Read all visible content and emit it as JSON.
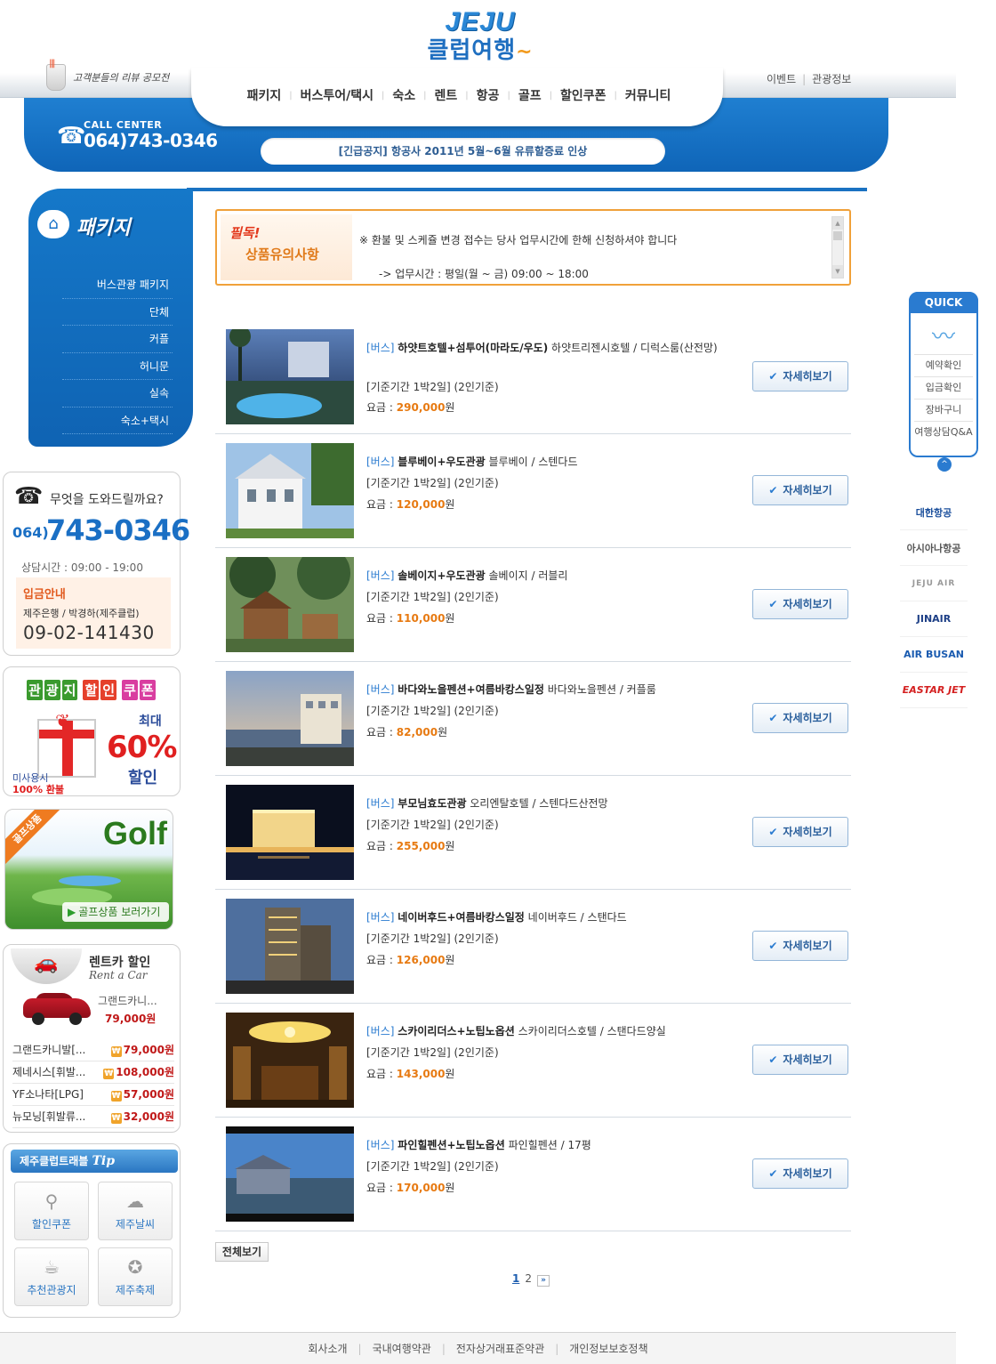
{
  "header": {
    "logo_top": "JEJU",
    "logo_main": "클럽여행",
    "review_banner": "고객분들의 리뷰 공모전",
    "util_links": [
      "이벤트",
      "관광정보"
    ],
    "nav": [
      "패키지",
      "버스투어/택시",
      "숙소",
      "렌트",
      "항공",
      "골프",
      "할인쿠폰",
      "커뮤니티"
    ],
    "call_center_label": "CALL CENTER",
    "call_center_number": "064)743-0346",
    "notice": "[긴급공지] 항공사 2011년 5월~6월 유류할증료 인상"
  },
  "sidebar": {
    "title": "패키지",
    "items": [
      "버스관광 패키지",
      "단체",
      "커플",
      "허니문",
      "실속",
      "숙소+택시"
    ]
  },
  "help": {
    "question": "무엇을 도와드릴까요?",
    "area_code": "064)",
    "number": "743-0346",
    "hours": "상담시간 : 09:00 - 19:00",
    "deposit_title": "입금안내",
    "bank": "제주은행 / 박경하(제주클럽)",
    "account": "09-02-141430"
  },
  "coupon": {
    "title_parts": [
      "관",
      "광",
      "지",
      "할",
      "인",
      "쿠",
      "폰"
    ],
    "max_label": "최대",
    "percent": "60%",
    "discount": "할인",
    "refund_line1": "미사용시",
    "refund_line2": "100% 환불"
  },
  "golf": {
    "ribbon": "골프상품",
    "title": "Golf",
    "link": "골프상품 보러가기"
  },
  "rentcar": {
    "title": "렌트카 할인",
    "subtitle": "Rent a Car",
    "featured_model": "그랜드카니...",
    "featured_price": "79,000원",
    "rows": [
      {
        "name": "그랜드카니발[...",
        "price": "79,000원"
      },
      {
        "name": "제네시스[휘발...",
        "price": "108,000원"
      },
      {
        "name": "YF소나타[LPG]",
        "price": "57,000원"
      },
      {
        "name": "뉴모닝[휘발류...",
        "price": "32,000원"
      }
    ]
  },
  "tips": {
    "title": "제주클럽트래블",
    "title_tip": "Tip",
    "tiles": [
      "할인쿠폰",
      "제주날씨",
      "추천관광지",
      "제주축제"
    ]
  },
  "warning": {
    "label1": "필독!",
    "label2": "상품유의사항",
    "line1": "※ 환불 및 스케쥴 변경 접수는 당사 업무시간에 한해 신청하셔야 합니다",
    "line2": "-> 업무시간 : 평일(월 ~ 금) 09:00 ~ 18:00"
  },
  "products": [
    {
      "tag": "[버스]",
      "name": "하얏트호텔+섬투어(마라도/우도)",
      "detail": "하얏트리젠시호텔 / 디럭스룸(산전망)",
      "period": "[기준기간 1박2일] (2인기준)",
      "price_label": "요금 : ",
      "price": "290,000",
      "won": "원",
      "button": "자세히보기"
    },
    {
      "tag": "[버스]",
      "name": "블루베이+우도관광",
      "detail": "블루베이 / 스텐다드",
      "period": "[기준기간 1박2일] (2인기준)",
      "price_label": "요금 : ",
      "price": "120,000",
      "won": "원",
      "button": "자세히보기"
    },
    {
      "tag": "[버스]",
      "name": "솔베이지+우도관광",
      "detail": "솔베이지 / 러블리",
      "period": "[기준기간 1박2일] (2인기준)",
      "price_label": "요금 : ",
      "price": "110,000",
      "won": "원",
      "button": "자세히보기"
    },
    {
      "tag": "[버스]",
      "name": "바다와노을펜션+여름바캉스일정",
      "detail": "바다와노을펜션 / 커플룸",
      "period": "[기준기간 1박2일] (2인기준)",
      "price_label": "요금 : ",
      "price": "82,000",
      "won": "원",
      "button": "자세히보기"
    },
    {
      "tag": "[버스]",
      "name": "부모님효도관광",
      "detail": "오리엔탈호텔 / 스텐다드산전망",
      "period": "[기준기간 1박2일] (2인기준)",
      "price_label": "요금 : ",
      "price": "255,000",
      "won": "원",
      "button": "자세히보기"
    },
    {
      "tag": "[버스]",
      "name": "네이버후드+여름바캉스일정",
      "detail": "네이버후드 / 스탠다드",
      "period": "[기준기간 1박2일] (2인기준)",
      "price_label": "요금 : ",
      "price": "126,000",
      "won": "원",
      "button": "자세히보기"
    },
    {
      "tag": "[버스]",
      "name": "스카이리더스+노팁노옵션",
      "detail": "스카이리더스호텔 / 스탠다드양실",
      "period": "[기준기간 1박2일] (2인기준)",
      "price_label": "요금 : ",
      "price": "143,000",
      "won": "원",
      "button": "자세히보기"
    },
    {
      "tag": "[버스]",
      "name": "파인힐펜션+노팁노옵션",
      "detail": "파인힐펜션 / 17평",
      "period": "[기준기간 1박2일] (2인기준)",
      "price_label": "요금 : ",
      "price": "170,000",
      "won": "원",
      "button": "자세히보기"
    }
  ],
  "list_footer": {
    "view_all": "전체보기",
    "pages": [
      "1",
      "2"
    ],
    "next": "»"
  },
  "quick": {
    "title": "QUICK",
    "items": [
      "예약확인",
      "입금확인",
      "장바구니",
      "여행상담Q&A"
    ],
    "top": "^"
  },
  "airlines": [
    "대한항공",
    "아시아나항공",
    "JEJU AIR",
    "JINAIR",
    "AIR BUSAN",
    "EASTAR JET"
  ],
  "footer": [
    "회사소개",
    "국내여행약관",
    "전자상거래표준약관",
    "개인정보보호정책"
  ]
}
